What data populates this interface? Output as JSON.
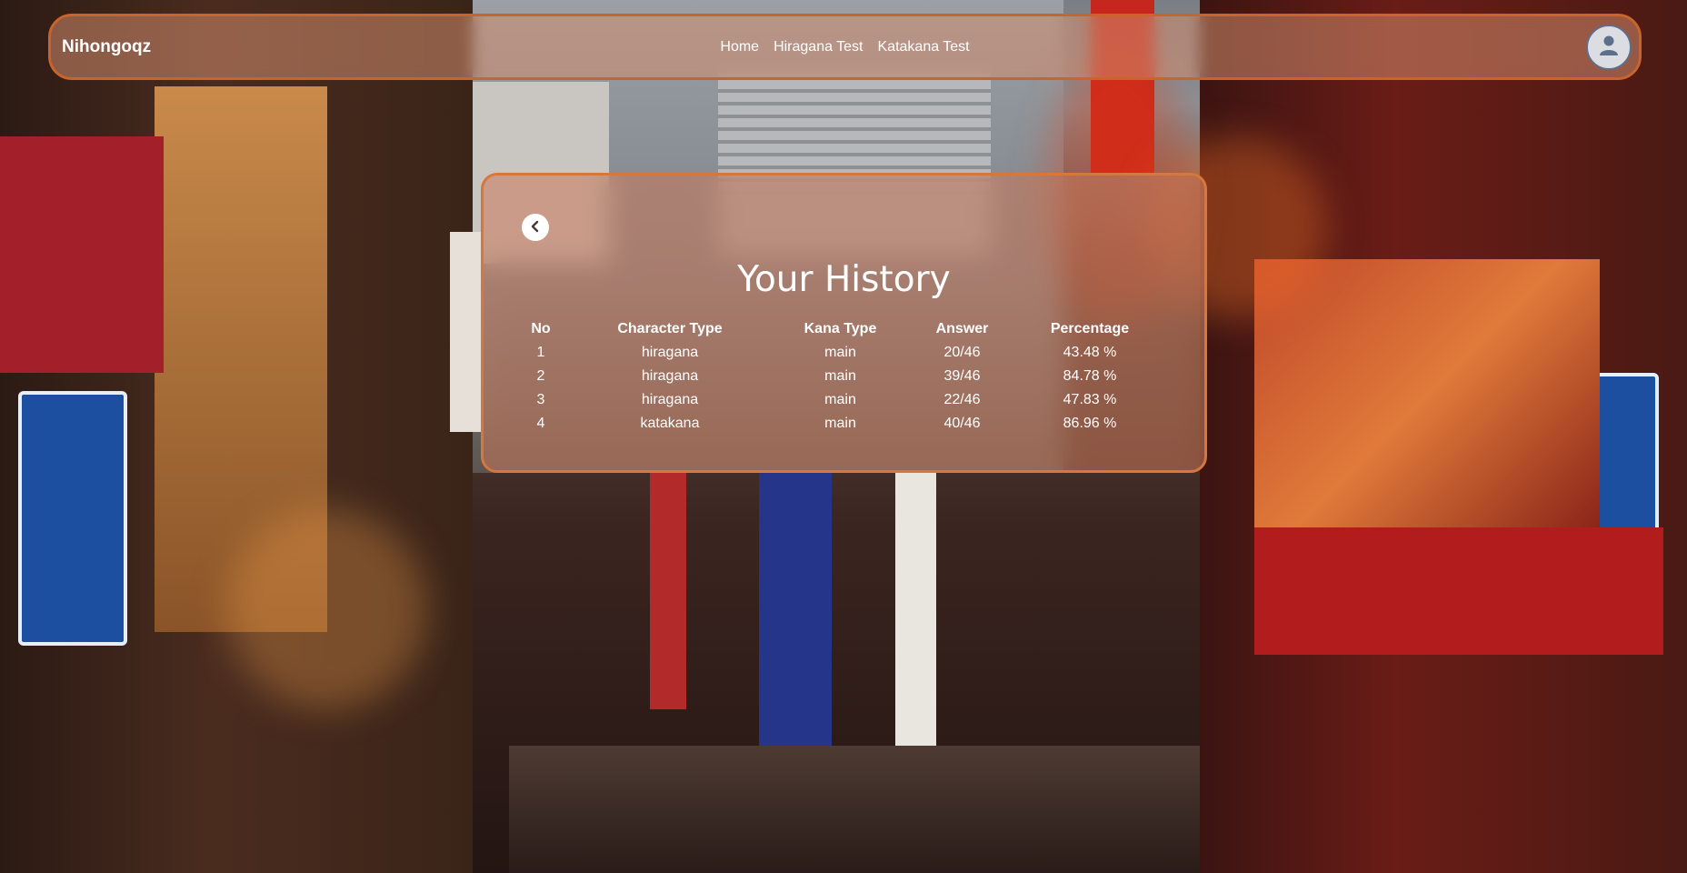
{
  "navbar": {
    "brand": "Nihongoqz",
    "links": [
      {
        "label": "Home"
      },
      {
        "label": "Hiragana Test"
      },
      {
        "label": "Katakana Test"
      }
    ],
    "avatar_icon": "user-avatar-icon"
  },
  "history": {
    "back_icon": "chevron-left-icon",
    "title": "Your History",
    "columns": [
      "No",
      "Character Type",
      "Kana Type",
      "Answer",
      "Percentage"
    ],
    "rows": [
      {
        "no": "1",
        "character_type": "hiragana",
        "kana_type": "main",
        "answer": "20/46",
        "percentage": "43.48 %"
      },
      {
        "no": "2",
        "character_type": "hiragana",
        "kana_type": "main",
        "answer": "39/46",
        "percentage": "84.78 %"
      },
      {
        "no": "3",
        "character_type": "hiragana",
        "kana_type": "main",
        "answer": "22/46",
        "percentage": "47.83 %"
      },
      {
        "no": "4",
        "character_type": "katakana",
        "kana_type": "main",
        "answer": "40/46",
        "percentage": "86.96 %"
      }
    ]
  },
  "colors": {
    "navbar_border": "#c9642b",
    "card_border": "#d6773d",
    "text": "#ffffff"
  }
}
